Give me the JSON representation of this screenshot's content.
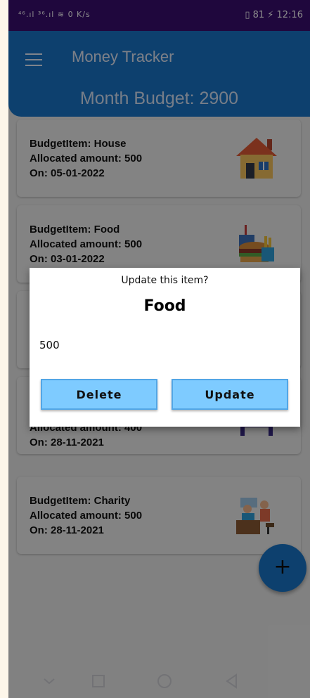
{
  "status_bar": {
    "signal_text": "⁴⁶.ıl ³⁶.ıl ≋ 0 K/s",
    "right_text": "▯ 81 ⚡ 12:16"
  },
  "app_bar": {
    "title": "Money Tracker",
    "month_budget": "Month Budget: 2900"
  },
  "budget_items": [
    {
      "name": "BudgetItem: House",
      "amount": "Allocated amount: 500",
      "date": "On: 05-01-2022",
      "icon": "house-icon"
    },
    {
      "name": "BudgetItem: Food",
      "amount": "Allocated amount: 500",
      "date": "On: 03-01-2022",
      "icon": "food-icon"
    },
    {
      "name": "",
      "amount": "",
      "date": "",
      "icon": ""
    },
    {
      "name": "",
      "amount": "Allocated amount: 400",
      "date": "On: 28-11-2021",
      "icon": "furniture-icon"
    },
    {
      "name": "BudgetItem: Charity",
      "amount": "Allocated amount: 500",
      "date": "On: 28-11-2021",
      "icon": "charity-icon"
    }
  ],
  "dialog": {
    "subtitle": "Update this item?",
    "title": "Food",
    "amount_value": "500",
    "delete_label": "Delete",
    "update_label": "Update"
  },
  "fab": {
    "label": "+"
  },
  "colors": {
    "status_bar": "#3a0d70",
    "app_bar": "#1976c9",
    "button": "#7ecbff"
  }
}
